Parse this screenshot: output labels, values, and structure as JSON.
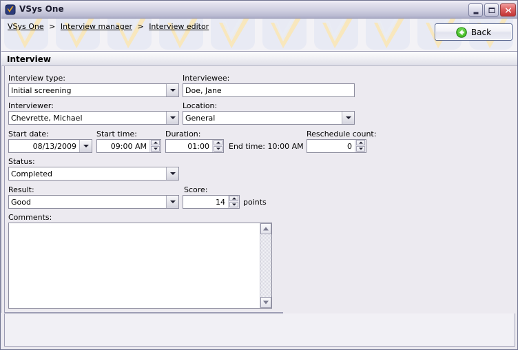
{
  "window": {
    "title": "VSys One",
    "icon": "vsys-checkmark-icon",
    "controls": {
      "minimize": "Minimize",
      "maximize": "Maximize",
      "close": "Close"
    }
  },
  "breadcrumb": {
    "separator": ">",
    "items": [
      {
        "label": "VSys One"
      },
      {
        "label": "Interview manager"
      },
      {
        "label": "Interview editor"
      }
    ]
  },
  "toolbar": {
    "back_label": "Back",
    "back_icon": "green-back-arrow-icon"
  },
  "section": {
    "title": "Interview"
  },
  "form": {
    "interview_type": {
      "label": "Interview type:",
      "value": "Initial screening"
    },
    "interviewee": {
      "label": "Interviewee:",
      "value": "Doe, Jane"
    },
    "interviewer": {
      "label": "Interviewer:",
      "value": "Chevrette, Michael"
    },
    "location": {
      "label": "Location:",
      "value": "General"
    },
    "start_date": {
      "label": "Start date:",
      "value": "08/13/2009"
    },
    "start_time": {
      "label": "Start time:",
      "value": "09:00 AM"
    },
    "duration": {
      "label": "Duration:",
      "value": "01:00"
    },
    "end_time": {
      "text": "End time: 10:00 AM"
    },
    "reschedule_count": {
      "label": "Reschedule count:",
      "value": "0"
    },
    "status": {
      "label": "Status:",
      "value": "Completed"
    },
    "result": {
      "label": "Result:",
      "value": "Good"
    },
    "score": {
      "label": "Score:",
      "value": "14",
      "unit": "points"
    },
    "comments": {
      "label": "Comments:",
      "value": ""
    }
  },
  "colors": {
    "window_background": "#eceaf0",
    "titlebar_gradient_start": "#f2f1f7",
    "titlebar_gradient_end": "#a9aac5",
    "field_border": "#8d8d9e",
    "field_background": "#ffffff",
    "close_button": "#c03434",
    "back_icon_green": "#2f9b1f",
    "watermark_blue": "#e4e6f2",
    "watermark_cream": "#f6e3b6"
  }
}
